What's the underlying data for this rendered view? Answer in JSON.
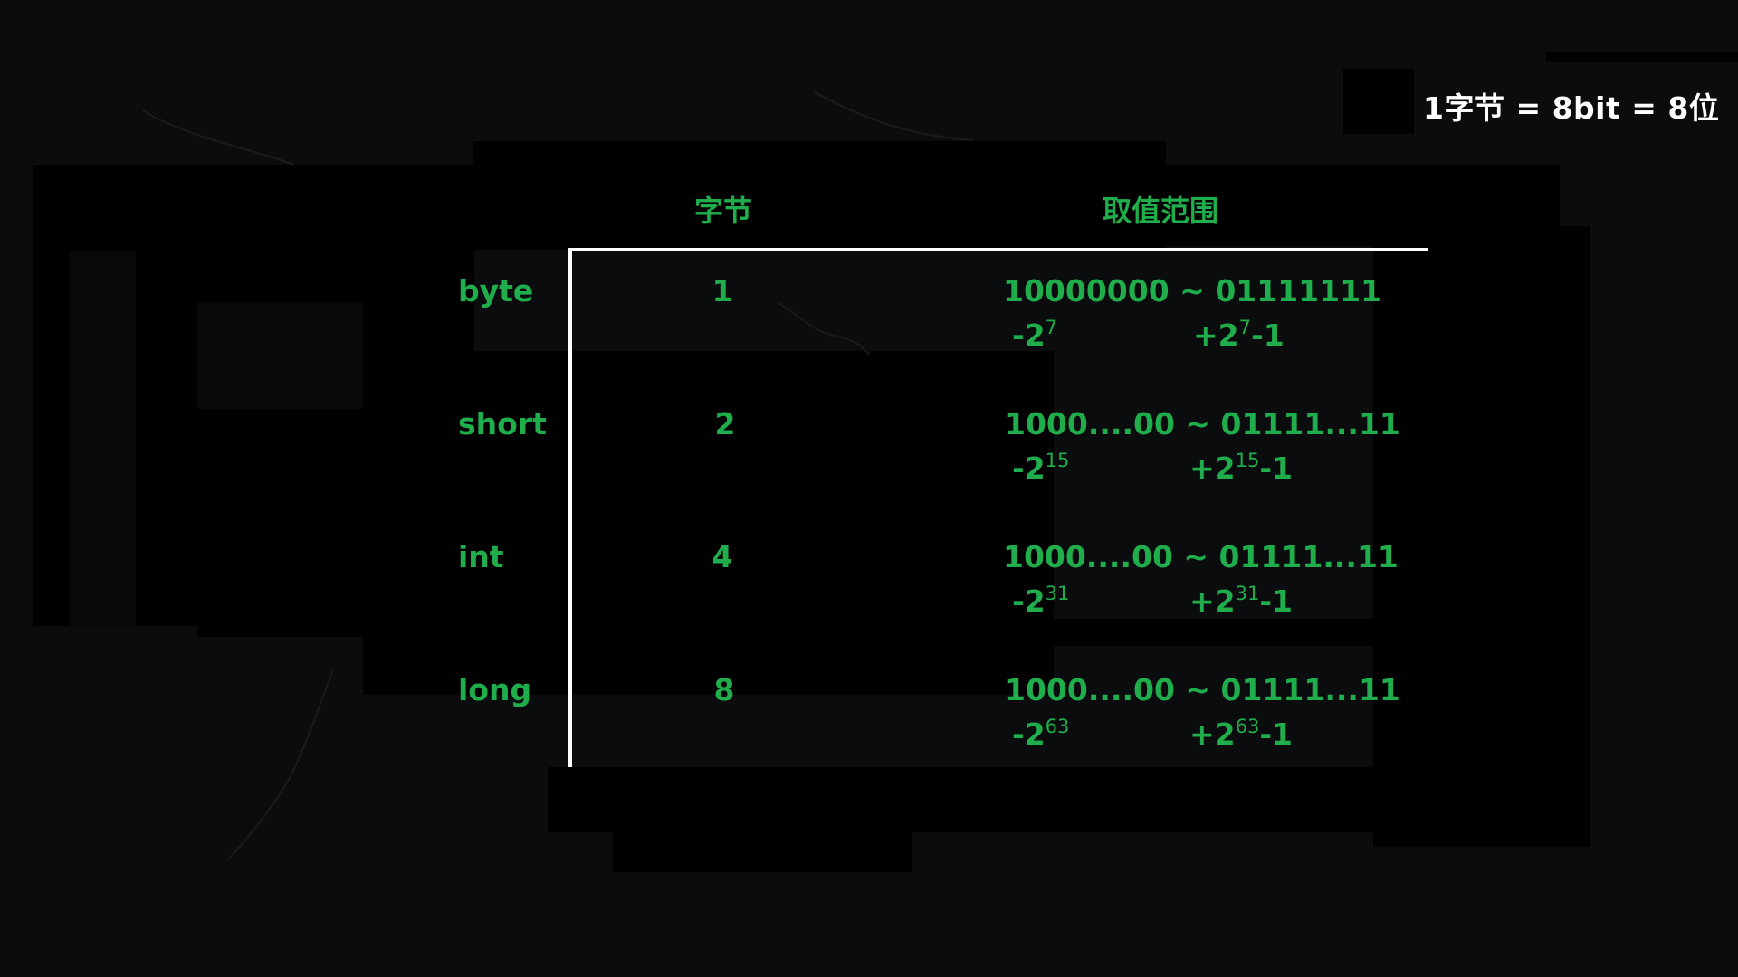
{
  "note": "1字节 = 8bit = 8位",
  "headers": {
    "bytes": "字节",
    "range": "取值范围"
  },
  "rows": [
    {
      "type": "byte",
      "bytes": "1",
      "binary": "10000000 ~ 01111111",
      "min_prefix": "-2",
      "min_exp": "7",
      "max_prefix": "+2",
      "max_exp": "7",
      "max_suffix": "-1"
    },
    {
      "type": "short",
      "bytes": "2",
      "binary": "1000....00 ~ 01111...11",
      "min_prefix": "-2",
      "min_exp": "15",
      "max_prefix": "+2",
      "max_exp": "15",
      "max_suffix": "-1"
    },
    {
      "type": "int",
      "bytes": "4",
      "binary": "1000....00 ~ 01111...11",
      "min_prefix": "-2",
      "min_exp": "31",
      "max_prefix": "+2",
      "max_exp": "31",
      "max_suffix": "-1"
    },
    {
      "type": "long",
      "bytes": "8",
      "binary": "1000....00 ~ 01111...11",
      "min_prefix": "-2",
      "min_exp": "63",
      "max_prefix": "+2",
      "max_exp": "63",
      "max_suffix": "-1"
    }
  ],
  "colors": {
    "background": "#0b0c0e",
    "text_green": "#1fae4b",
    "text_white": "#ffffff",
    "bracket": "#ffffff"
  }
}
